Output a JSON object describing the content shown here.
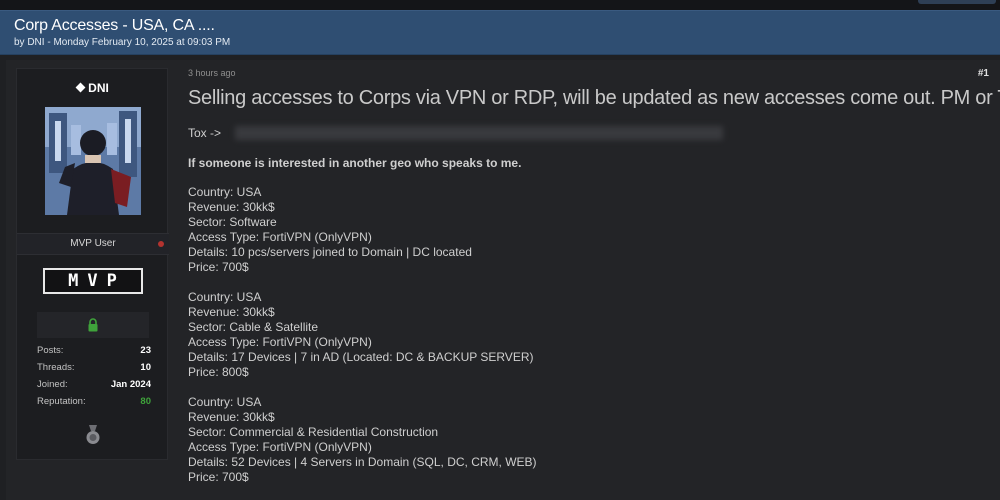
{
  "thread": {
    "title": "Corp Accesses - USA, CA ....",
    "meta": "by DNI - Monday February 10, 2025 at 09:03 PM"
  },
  "user": {
    "name": "DNI",
    "role": "MVP User",
    "badge": "MVP",
    "stats": [
      {
        "label": "Posts:",
        "value": "23"
      },
      {
        "label": "Threads:",
        "value": "10"
      },
      {
        "label": "Joined:",
        "value": "Jan 2024"
      },
      {
        "label": "Reputation:",
        "value": "80"
      }
    ],
    "reputation_color": "#3fa33b"
  },
  "post": {
    "time": "3 hours ago",
    "number": "#1",
    "heading": "Selling accesses to Corps via VPN or RDP, will be updated as new accesses come out. PM or TOX",
    "tox_label": "Tox ->",
    "interest_line": "If someone is interested in another geo who speaks to me.",
    "listings": [
      {
        "country": "Country: USA",
        "revenue": "Revenue: 30kk$",
        "sector": "Sector: Software",
        "access": "Access Type: FortiVPN (OnlyVPN)",
        "details": "Details: 10 pcs/servers joined to Domain | DC located",
        "price": "Price: 700$"
      },
      {
        "country": "Country: USA",
        "revenue": "Revenue: 30kk$",
        "sector": "Sector: Cable & Satellite",
        "access": "Access Type: FortiVPN (OnlyVPN)",
        "details": "Details: 17 Devices | 7 in AD (Located: DC & BACKUP SERVER)",
        "price": "Price: 800$"
      },
      {
        "country": "Country: USA",
        "revenue": "Revenue: 30kk$",
        "sector": "Sector: Commercial & Residential Construction",
        "access": "Access Type: FortiVPN (OnlyVPN)",
        "details": "Details: 52 Devices | 4 Servers in Domain (SQL, DC, CRM, WEB)",
        "price": "Price: 700$"
      }
    ]
  },
  "icons": {
    "username_prefix": "diamond-icon",
    "lock": "lock-icon",
    "medal": "medal-icon"
  },
  "colors": {
    "header_bg": "#2f4e72",
    "page_bg": "#1f2023",
    "online_dot": "#b3332f",
    "lock": "#3fa33b"
  }
}
